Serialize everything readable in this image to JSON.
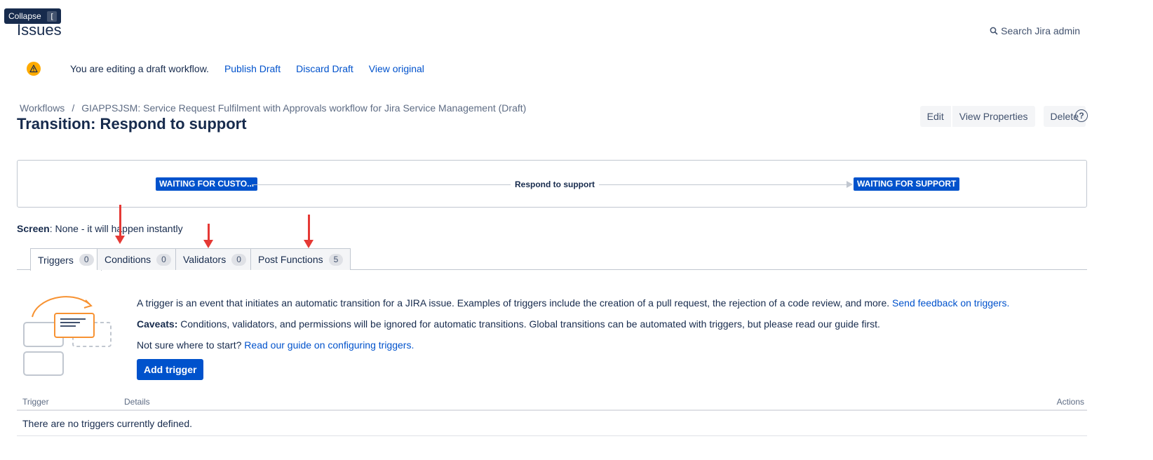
{
  "tooltip": {
    "label": "Collapse",
    "shortcut": "["
  },
  "header": {
    "title": "Issues",
    "search_label": "Search Jira admin"
  },
  "draft_bar": {
    "message": "You are editing a draft workflow.",
    "publish": "Publish Draft",
    "discard": "Discard Draft",
    "view_original": "View original"
  },
  "breadcrumb": {
    "root": "Workflows",
    "separator": "/",
    "workflow": "GIAPPSJSM: Service Request Fulfilment with Approvals workflow for Jira Service Management (Draft)"
  },
  "transition": {
    "title": "Transition: Respond to support"
  },
  "actions": {
    "edit": "Edit",
    "view_properties": "View Properties",
    "delete": "Delete",
    "help": "?"
  },
  "diagram": {
    "from_status": "WAITING FOR CUSTO...",
    "transition_name": "Respond to support",
    "to_status": "WAITING FOR SUPPORT"
  },
  "screen": {
    "label": "Screen",
    "value": ": None - it will happen instantly"
  },
  "tabs": [
    {
      "label": "Triggers",
      "count": "0"
    },
    {
      "label": "Conditions",
      "count": "0"
    },
    {
      "label": "Validators",
      "count": "0"
    },
    {
      "label": "Post Functions",
      "count": "5"
    }
  ],
  "triggers": {
    "description": "A trigger is an event that initiates an automatic transition for a JIRA issue. Examples of triggers include the creation of a pull request, the rejection of a code review, and more.",
    "feedback_link": "Send feedback on triggers.",
    "caveats_label": "Caveats:",
    "caveats_text": " Conditions, validators, and permissions will be ignored for automatic transitions. Global transitions can be automated with triggers, but please read our guide first.",
    "not_sure": "Not sure where to start?",
    "guide_link": "Read our guide on configuring triggers.",
    "add_button": "Add trigger"
  },
  "table": {
    "headers": {
      "trigger": "Trigger",
      "details": "Details",
      "actions": "Actions"
    },
    "empty_message": "There are no triggers currently defined."
  },
  "colors": {
    "accent": "#0052cc",
    "warning": "#ffab00",
    "annotation_arrow": "#e53935"
  }
}
